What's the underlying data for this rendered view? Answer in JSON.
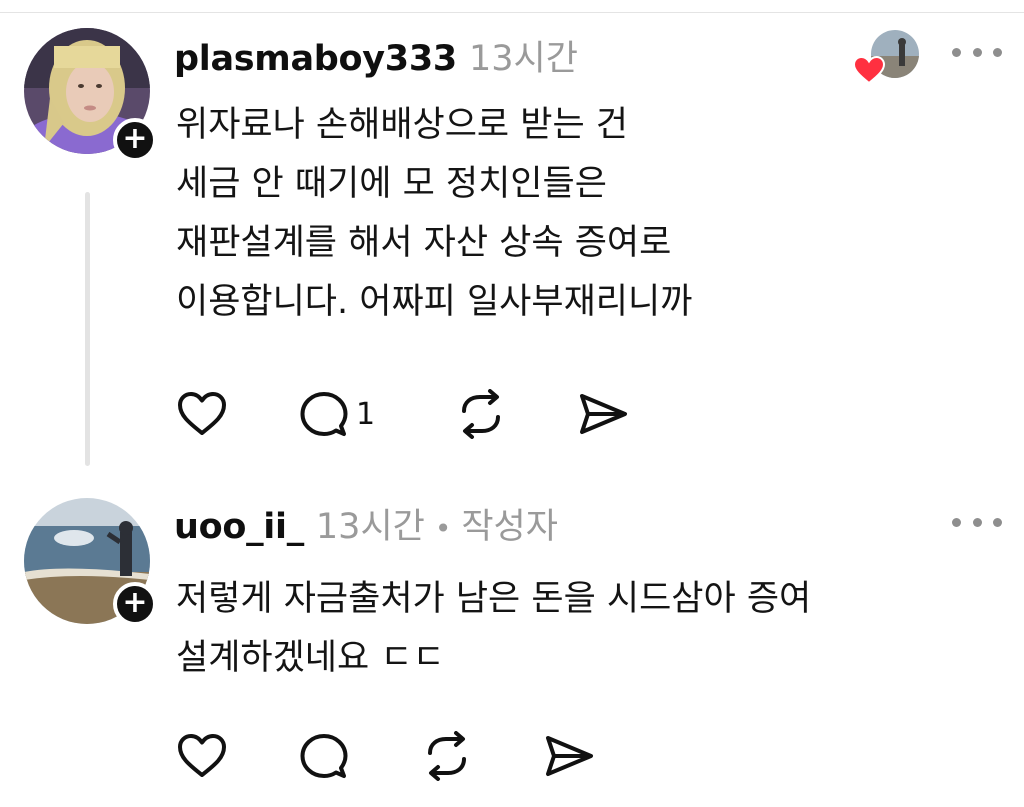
{
  "posts": [
    {
      "username": "plasmaboy333",
      "time": "13시간",
      "lines": [
        "위자료나 손해배상으로 받는 건",
        "세금 안 때기에 모 정치인들은",
        "재판설계를 해서 자산 상속 증여로",
        "이용합니다. 어짜피 일사부재리니까"
      ],
      "reply_count": "1",
      "icons": {
        "like": "heart-icon",
        "reply": "comment-icon",
        "repost": "repost-icon",
        "share": "send-icon",
        "more": "more-icon",
        "follow": "plus-icon"
      }
    },
    {
      "username": "uoo_ii_",
      "time": "13시간",
      "separator": "•",
      "author_tag": "작성자",
      "lines": [
        "저렇게 자금출처가 남은 돈을 시드삼아 증여",
        "설계하겠네요 ㄷㄷ"
      ],
      "icons": {
        "like": "heart-icon",
        "reply": "comment-icon",
        "repost": "repost-icon",
        "share": "send-icon",
        "more": "more-icon",
        "follow": "plus-icon"
      }
    }
  ],
  "follow_symbol": "+",
  "colors": {
    "text": "#141414",
    "muted": "#9a9a9a",
    "heart": "#ff3040",
    "thread_line": "#e3e3e3"
  }
}
